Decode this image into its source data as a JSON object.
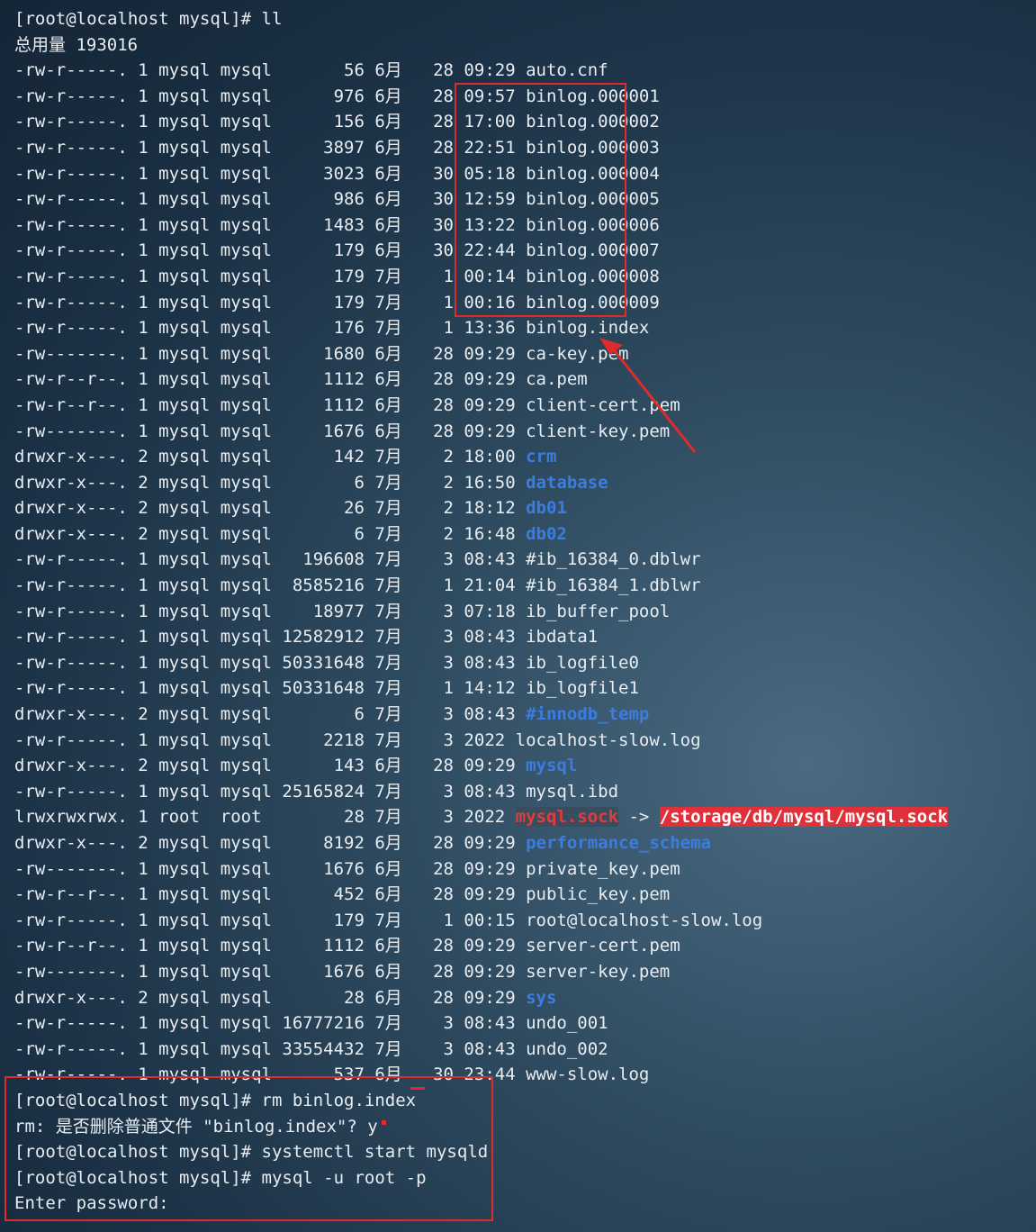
{
  "terminal": {
    "command": "[root@localhost mysql]# ll",
    "total": "总用量 193016",
    "entries": [
      {
        "meta": "-rw-r-----. 1 mysql mysql       56 6月   28 09:29 ",
        "name": "auto.cnf",
        "type": "file"
      },
      {
        "meta": "-rw-r-----. 1 mysql mysql      976 6月   28 09:57 ",
        "name": "binlog.000001",
        "type": "file"
      },
      {
        "meta": "-rw-r-----. 1 mysql mysql      156 6月   28 17:00 ",
        "name": "binlog.000002",
        "type": "file"
      },
      {
        "meta": "-rw-r-----. 1 mysql mysql     3897 6月   28 22:51 ",
        "name": "binlog.000003",
        "type": "file"
      },
      {
        "meta": "-rw-r-----. 1 mysql mysql     3023 6月   30 05:18 ",
        "name": "binlog.000004",
        "type": "file"
      },
      {
        "meta": "-rw-r-----. 1 mysql mysql      986 6月   30 12:59 ",
        "name": "binlog.000005",
        "type": "file"
      },
      {
        "meta": "-rw-r-----. 1 mysql mysql     1483 6月   30 13:22 ",
        "name": "binlog.000006",
        "type": "file"
      },
      {
        "meta": "-rw-r-----. 1 mysql mysql      179 6月   30 22:44 ",
        "name": "binlog.000007",
        "type": "file"
      },
      {
        "meta": "-rw-r-----. 1 mysql mysql      179 7月    1 00:14 ",
        "name": "binlog.000008",
        "type": "file"
      },
      {
        "meta": "-rw-r-----. 1 mysql mysql      179 7月    1 00:16 ",
        "name": "binlog.000009",
        "type": "file"
      },
      {
        "meta": "-rw-r-----. 1 mysql mysql      176 7月    1 13:36 ",
        "name": "binlog.index",
        "type": "file"
      },
      {
        "meta": "-rw-------. 1 mysql mysql     1680 6月   28 09:29 ",
        "name": "ca-key.pem",
        "type": "file"
      },
      {
        "meta": "-rw-r--r--. 1 mysql mysql     1112 6月   28 09:29 ",
        "name": "ca.pem",
        "type": "file"
      },
      {
        "meta": "-rw-r--r--. 1 mysql mysql     1112 6月   28 09:29 ",
        "name": "client-cert.pem",
        "type": "file"
      },
      {
        "meta": "-rw-------. 1 mysql mysql     1676 6月   28 09:29 ",
        "name": "client-key.pem",
        "type": "file"
      },
      {
        "meta": "drwxr-x---. 2 mysql mysql      142 7月    2 18:00 ",
        "name": "crm",
        "type": "dir"
      },
      {
        "meta": "drwxr-x---. 2 mysql mysql        6 7月    2 16:50 ",
        "name": "database",
        "type": "dir"
      },
      {
        "meta": "drwxr-x---. 2 mysql mysql       26 7月    2 18:12 ",
        "name": "db01",
        "type": "dir"
      },
      {
        "meta": "drwxr-x---. 2 mysql mysql        6 7月    2 16:48 ",
        "name": "db02",
        "type": "dir"
      },
      {
        "meta": "-rw-r-----. 1 mysql mysql   196608 7月    3 08:43 ",
        "name": "#ib_16384_0.dblwr",
        "type": "file"
      },
      {
        "meta": "-rw-r-----. 1 mysql mysql  8585216 7月    1 21:04 ",
        "name": "#ib_16384_1.dblwr",
        "type": "file"
      },
      {
        "meta": "-rw-r-----. 1 mysql mysql    18977 7月    3 07:18 ",
        "name": "ib_buffer_pool",
        "type": "file"
      },
      {
        "meta": "-rw-r-----. 1 mysql mysql 12582912 7月    3 08:43 ",
        "name": "ibdata1",
        "type": "file"
      },
      {
        "meta": "-rw-r-----. 1 mysql mysql 50331648 7月    3 08:43 ",
        "name": "ib_logfile0",
        "type": "file"
      },
      {
        "meta": "-rw-r-----. 1 mysql mysql 50331648 7月    1 14:12 ",
        "name": "ib_logfile1",
        "type": "file"
      },
      {
        "meta": "drwxr-x---. 2 mysql mysql        6 7月    3 08:43 ",
        "name": "#innodb_temp",
        "type": "dir"
      },
      {
        "meta": "-rw-r-----. 1 mysql mysql     2218 7月    3 2022 ",
        "name": "localhost-slow.log",
        "type": "file"
      },
      {
        "meta": "drwxr-x---. 2 mysql mysql      143 6月   28 09:29 ",
        "name": "mysql",
        "type": "dir"
      },
      {
        "meta": "-rw-r-----. 1 mysql mysql 25165824 7月    3 08:43 ",
        "name": "mysql.ibd",
        "type": "file"
      },
      {
        "meta": "lrwxrwxrwx. 1 root  root        28 7月    3 2022 ",
        "name": "mysql.sock",
        "arrow": " -> ",
        "target": "/storage/db/mysql/mysql.sock",
        "type": "link"
      },
      {
        "meta": "drwxr-x---. 2 mysql mysql     8192 6月   28 09:29 ",
        "name": "performance_schema",
        "type": "dir"
      },
      {
        "meta": "-rw-------. 1 mysql mysql     1676 6月   28 09:29 ",
        "name": "private_key.pem",
        "type": "file"
      },
      {
        "meta": "-rw-r--r--. 1 mysql mysql      452 6月   28 09:29 ",
        "name": "public_key.pem",
        "type": "file"
      },
      {
        "meta": "-rw-r-----. 1 mysql mysql      179 7月    1 00:15 ",
        "name": "root@localhost-slow.log",
        "type": "file"
      },
      {
        "meta": "-rw-r--r--. 1 mysql mysql     1112 6月   28 09:29 ",
        "name": "server-cert.pem",
        "type": "file"
      },
      {
        "meta": "-rw-------. 1 mysql mysql     1676 6月   28 09:29 ",
        "name": "server-key.pem",
        "type": "file"
      },
      {
        "meta": "drwxr-x---. 2 mysql mysql       28 6月   28 09:29 ",
        "name": "sys",
        "type": "dir"
      },
      {
        "meta": "-rw-r-----. 1 mysql mysql 16777216 7月    3 08:43 ",
        "name": "undo_001",
        "type": "file"
      },
      {
        "meta": "-rw-r-----. 1 mysql mysql 33554432 7月    3 08:43 ",
        "name": "undo_002",
        "type": "file"
      },
      {
        "meta": "-rw-r-----. 1 mysql mysql      537 6月   30 23:44 ",
        "name": "www-slow.log",
        "type": "file"
      }
    ],
    "tail": [
      "[root@localhost mysql]# rm binlog.index",
      "rm: 是否删除普通文件 \"binlog.index\"? y",
      "[root@localhost mysql]# systemctl start mysqld",
      "[root@localhost mysql]# mysql -u root -p",
      "Enter password: "
    ]
  },
  "colors": {
    "directory": "#3b7de0",
    "annotation": "#e02b2b",
    "symlink_target_bg": "#e0303a"
  }
}
